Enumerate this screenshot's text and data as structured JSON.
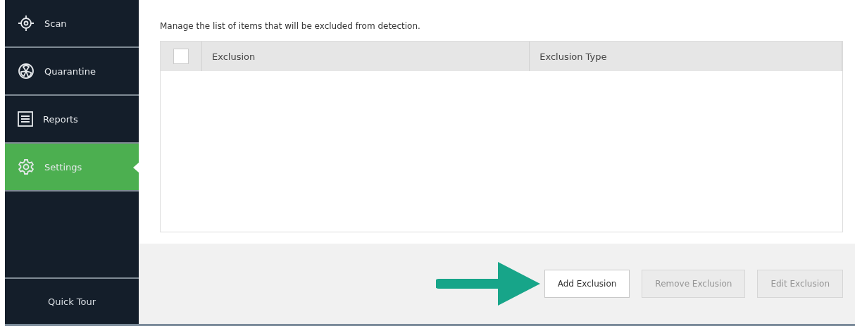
{
  "sidebar": {
    "items": [
      {
        "kind": "scan",
        "label": "Scan",
        "selected": false
      },
      {
        "kind": "quarantine",
        "label": "Quarantine",
        "selected": false
      },
      {
        "kind": "reports",
        "label": "Reports",
        "selected": false
      },
      {
        "kind": "settings",
        "label": "Settings",
        "selected": true
      }
    ],
    "footer_link": "Quick Tour"
  },
  "description": "Manage the list of items that will be excluded from detection.",
  "table": {
    "select_all_checked": false,
    "columns": [
      "Exclusion",
      "Exclusion Type"
    ]
  },
  "buttons": [
    {
      "label": "Add Exclusion",
      "disabled": false
    },
    {
      "label": "Remove Exclusion",
      "disabled": true
    },
    {
      "label": "Edit Exclusion",
      "disabled": true
    }
  ]
}
